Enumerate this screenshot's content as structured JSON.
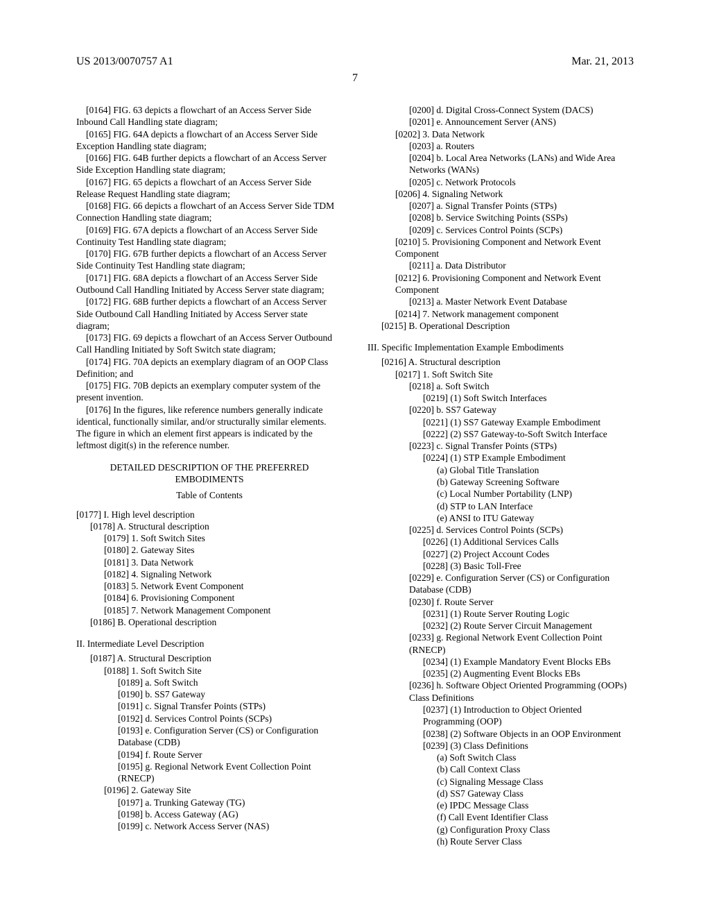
{
  "header": {
    "left": "US 2013/0070757 A1",
    "right": "Mar. 21, 2013"
  },
  "page_number": "7",
  "col1": {
    "paras": [
      "[0164]    FIG. 63 depicts a flowchart of an Access Server Side Inbound Call Handling state diagram;",
      "[0165]    FIG. 64A depicts a flowchart of an Access Server Side Exception Handling state diagram;",
      "[0166]    FIG. 64B further depicts a flowchart of an Access Server Side Exception Handling state diagram;",
      "[0167]    FIG. 65 depicts a flowchart of an Access Server Side Release Request Handling state diagram;",
      "[0168]    FIG. 66 depicts a flowchart of an Access Server Side TDM Connection Handling state diagram;",
      "[0169]    FIG. 67A depicts a flowchart of an Access Server Side Continuity Test Handling state diagram;",
      "[0170]    FIG. 67B further depicts a flowchart of an Access Server Side Continuity Test Handling state diagram;",
      "[0171]    FIG. 68A depicts a flowchart of an Access Server Side Outbound Call Handling Initiated by Access Server state diagram;",
      "[0172]    FIG. 68B further depicts a flowchart of an Access Server Side Outbound Call Handling Initiated by Access Server state diagram;",
      "[0173]    FIG. 69 depicts a flowchart of an Access Server Outbound Call Handling Initiated by Soft Switch state diagram;",
      "[0174]    FIG. 70A depicts an exemplary diagram of an OOP Class Definition; and",
      "[0175]    FIG. 70B depicts an exemplary computer system of the present invention.",
      "[0176]    In the figures, like reference numbers generally indicate identical, functionally similar, and/or structurally similar elements. The figure in which an element first appears is indicated by the leftmost digit(s) in the reference number."
    ],
    "heading1": "DETAILED DESCRIPTION OF THE PREFERRED EMBODIMENTS",
    "heading2": "Table of Contents",
    "toc_a": [
      {
        "L": 1,
        "t": "[0177]    I. High level description"
      },
      {
        "L": 2,
        "t": "[0178]    A. Structural description"
      },
      {
        "L": 3,
        "t": "[0179]    1. Soft Switch Sites"
      },
      {
        "L": 3,
        "t": "[0180]    2. Gateway Sites"
      },
      {
        "L": 3,
        "t": "[0181]    3. Data Network"
      },
      {
        "L": 3,
        "t": "[0182]    4. Signaling Network"
      },
      {
        "L": 3,
        "t": "[0183]    5. Network Event Component"
      },
      {
        "L": 3,
        "t": "[0184]    6. Provisioning Component"
      },
      {
        "L": 3,
        "t": "[0185]    7. Network Management Component"
      },
      {
        "L": 2,
        "t": "[0186]    B. Operational description"
      }
    ],
    "sec2": "II. Intermediate Level Description",
    "toc_b": [
      {
        "L": 2,
        "t": "[0187]    A. Structural Description"
      },
      {
        "L": 3,
        "t": "[0188]    1. Soft Switch Site"
      },
      {
        "L": 4,
        "t": "[0189]    a. Soft Switch"
      },
      {
        "L": 4,
        "t": "[0190]    b. SS7 Gateway"
      },
      {
        "L": 4,
        "t": "[0191]    c. Signal Transfer Points (STPs)"
      },
      {
        "L": 4,
        "t": "[0192]    d. Services Control Points (SCPs)"
      },
      {
        "L": 4,
        "t": "[0193]    e. Configuration Server (CS) or Configuration Database (CDB)"
      },
      {
        "L": 4,
        "t": "[0194]    f. Route Server"
      },
      {
        "L": 4,
        "t": "[0195]    g. Regional Network Event Collection Point (RNECP)"
      },
      {
        "L": 3,
        "t": "[0196]    2. Gateway Site"
      },
      {
        "L": 4,
        "t": "[0197]    a. Trunking Gateway (TG)"
      },
      {
        "L": 4,
        "t": "[0198]    b. Access Gateway (AG)"
      },
      {
        "L": 4,
        "t": "[0199]    c. Network Access Server (NAS)"
      }
    ]
  },
  "col2": {
    "toc_c": [
      {
        "L": 4,
        "t": "[0200]    d. Digital Cross-Connect System (DACS)"
      },
      {
        "L": 4,
        "t": "[0201]    e. Announcement Server (ANS)"
      },
      {
        "L": 3,
        "t": "[0202]    3. Data Network"
      },
      {
        "L": 4,
        "t": "[0203]    a. Routers"
      },
      {
        "L": 4,
        "t": "[0204]    b. Local Area Networks (LANs) and Wide Area Networks (WANs)"
      },
      {
        "L": 4,
        "t": "[0205]    c. Network Protocols"
      },
      {
        "L": 3,
        "t": "[0206]    4. Signaling Network"
      },
      {
        "L": 4,
        "t": "[0207]    a. Signal Transfer Points (STPs)"
      },
      {
        "L": 4,
        "t": "[0208]    b. Service Switching Points (SSPs)"
      },
      {
        "L": 4,
        "t": "[0209]    c. Services Control Points (SCPs)"
      },
      {
        "L": 3,
        "t": "[0210]    5. Provisioning Component and Network Event Component"
      },
      {
        "L": 4,
        "t": "[0211]    a. Data Distributor"
      },
      {
        "L": 3,
        "t": "[0212]    6. Provisioning Component and Network Event Component"
      },
      {
        "L": 4,
        "t": "[0213]    a. Master Network Event Database"
      },
      {
        "L": 3,
        "t": "[0214]    7. Network management component"
      },
      {
        "L": 2,
        "t": "[0215]    B. Operational Description"
      }
    ],
    "sec3": "III. Specific Implementation Example Embodiments",
    "toc_d": [
      {
        "L": 2,
        "t": "[0216]    A. Structural description"
      },
      {
        "L": 3,
        "t": "[0217]    1. Soft Switch Site"
      },
      {
        "L": 4,
        "t": "[0218]    a. Soft Switch"
      },
      {
        "L": 5,
        "t": "[0219]    (1) Soft Switch Interfaces"
      },
      {
        "L": 4,
        "t": "[0220]    b. SS7 Gateway"
      },
      {
        "L": 5,
        "t": "[0221]    (1) SS7 Gateway Example Embodiment"
      },
      {
        "L": 5,
        "t": "[0222]    (2) SS7 Gateway-to-Soft Switch Interface"
      },
      {
        "L": 4,
        "t": "[0223]    c. Signal Transfer Points (STPs)"
      },
      {
        "L": 5,
        "t": "[0224]    (1) STP Example Embodiment"
      },
      {
        "L": 6,
        "t": "(a) Global Title Translation"
      },
      {
        "L": 6,
        "t": "(b) Gateway Screening Software"
      },
      {
        "L": 6,
        "t": "(c) Local Number Portability (LNP)"
      },
      {
        "L": 6,
        "t": "(d) STP to LAN Interface"
      },
      {
        "L": 6,
        "t": "(e) ANSI to ITU Gateway"
      },
      {
        "L": 4,
        "t": "[0225]    d. Services Control Points (SCPs)"
      },
      {
        "L": 5,
        "t": "[0226]    (1) Additional Services Calls"
      },
      {
        "L": 5,
        "t": "[0227]    (2) Project Account Codes"
      },
      {
        "L": 5,
        "t": "[0228]    (3) Basic Toll-Free"
      },
      {
        "L": 4,
        "t": "[0229]    e. Configuration Server (CS) or Configuration Database (CDB)"
      },
      {
        "L": 4,
        "t": "[0230]    f. Route Server"
      },
      {
        "L": 5,
        "t": "[0231]    (1) Route Server Routing Logic"
      },
      {
        "L": 5,
        "t": "[0232]    (2) Route Server Circuit Management"
      },
      {
        "L": 4,
        "t": "[0233]    g. Regional Network Event Collection Point (RNECP)"
      },
      {
        "L": 5,
        "t": "[0234]    (1) Example Mandatory Event Blocks EBs"
      },
      {
        "L": 5,
        "t": "[0235]    (2) Augmenting Event Blocks EBs"
      },
      {
        "L": 4,
        "t": "[0236]    h. Software Object Oriented Programming (OOPs) Class Definitions"
      },
      {
        "L": 5,
        "t": "[0237]    (1) Introduction to Object Oriented Programming (OOP)"
      },
      {
        "L": 5,
        "t": "[0238]    (2) Software Objects in an OOP Environment"
      },
      {
        "L": 5,
        "t": "[0239]    (3) Class Definitions"
      },
      {
        "L": 6,
        "t": "(a) Soft Switch Class"
      },
      {
        "L": 6,
        "t": "(b) Call Context Class"
      },
      {
        "L": 6,
        "t": "(c) Signaling Message Class"
      },
      {
        "L": 6,
        "t": "(d) SS7 Gateway Class"
      },
      {
        "L": 6,
        "t": "(e) IPDC Message Class"
      },
      {
        "L": 6,
        "t": "(f) Call Event Identifier Class"
      },
      {
        "L": 6,
        "t": "(g) Configuration Proxy Class"
      },
      {
        "L": 6,
        "t": "(h) Route Server Class"
      }
    ]
  }
}
